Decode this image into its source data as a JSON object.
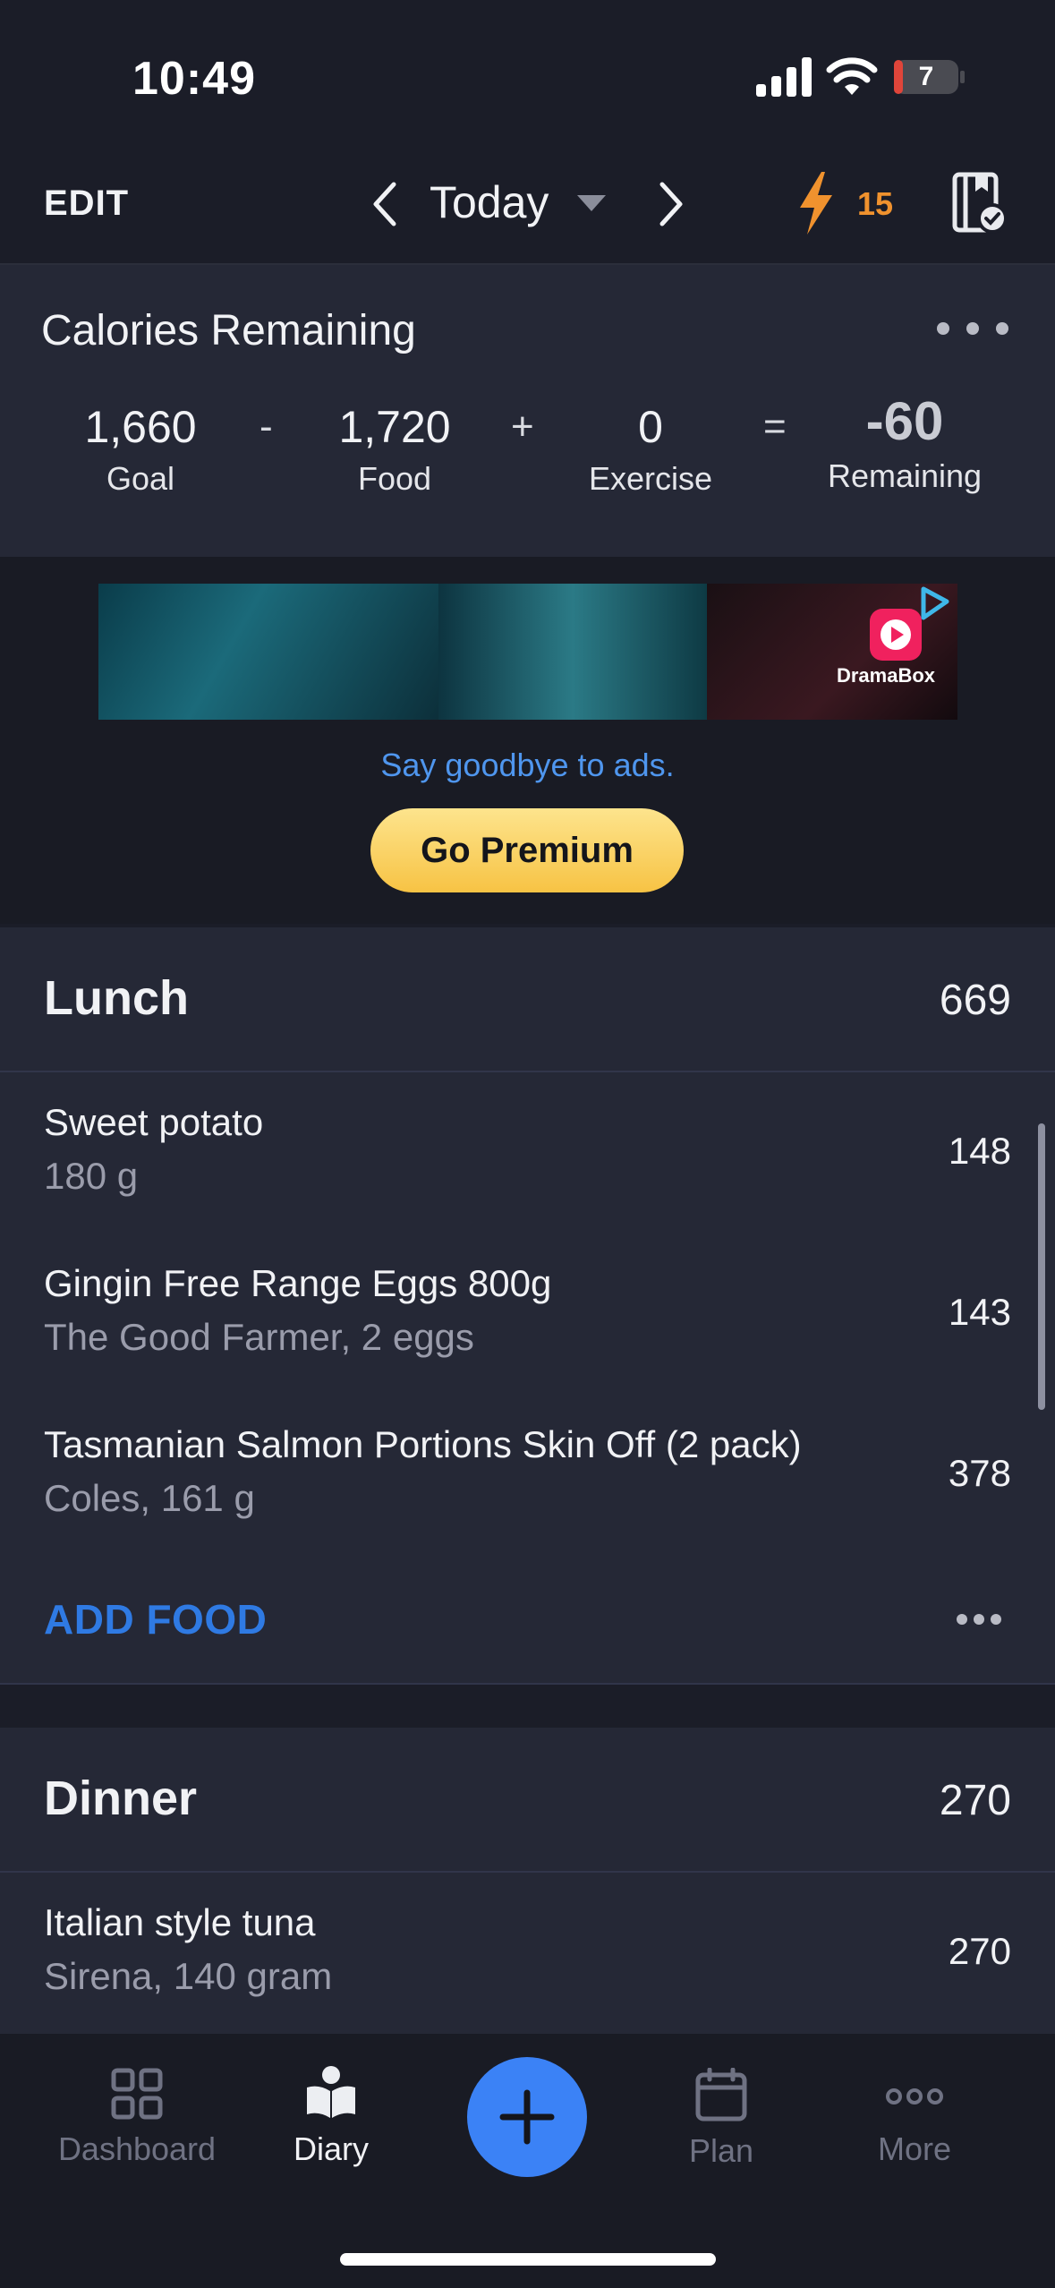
{
  "status_bar": {
    "time": "10:49",
    "battery": "7"
  },
  "header": {
    "edit": "EDIT",
    "date": "Today",
    "streak": "15"
  },
  "calories": {
    "title": "Calories Remaining",
    "goal": {
      "value": "1,660",
      "label": "Goal"
    },
    "minus": "-",
    "food": {
      "value": "1,720",
      "label": "Food"
    },
    "plus": "+",
    "exercise": {
      "value": "0",
      "label": "Exercise"
    },
    "equals": "=",
    "remaining": {
      "value": "-60",
      "label": "Remaining"
    }
  },
  "ad": {
    "brand": "DramaBox",
    "goodbye": "Say goodbye to ads.",
    "premium_button": "Go Premium"
  },
  "lunch": {
    "title": "Lunch",
    "total": "669",
    "items": [
      {
        "name": "Sweet potato",
        "detail": "180 g",
        "calories": "148"
      },
      {
        "name": "Gingin Free Range Eggs 800g",
        "detail": "The Good Farmer, 2 eggs",
        "calories": "143"
      },
      {
        "name": "Tasmanian Salmon Portions Skin Off (2 pack)",
        "detail": "Coles, 161 g",
        "calories": "378"
      }
    ],
    "add_food": "ADD FOOD"
  },
  "dinner": {
    "title": "Dinner",
    "total": "270",
    "items": [
      {
        "name": "Italian style tuna",
        "detail": "Sirena, 140 gram",
        "calories": "270"
      }
    ]
  },
  "tabs": {
    "dashboard": "Dashboard",
    "diary": "Diary",
    "plan": "Plan",
    "more": "More"
  },
  "colors": {
    "accent": "#3b82f6",
    "streak": "#f0922e",
    "premium": "#f7c344",
    "link": "#2f7ae3"
  }
}
